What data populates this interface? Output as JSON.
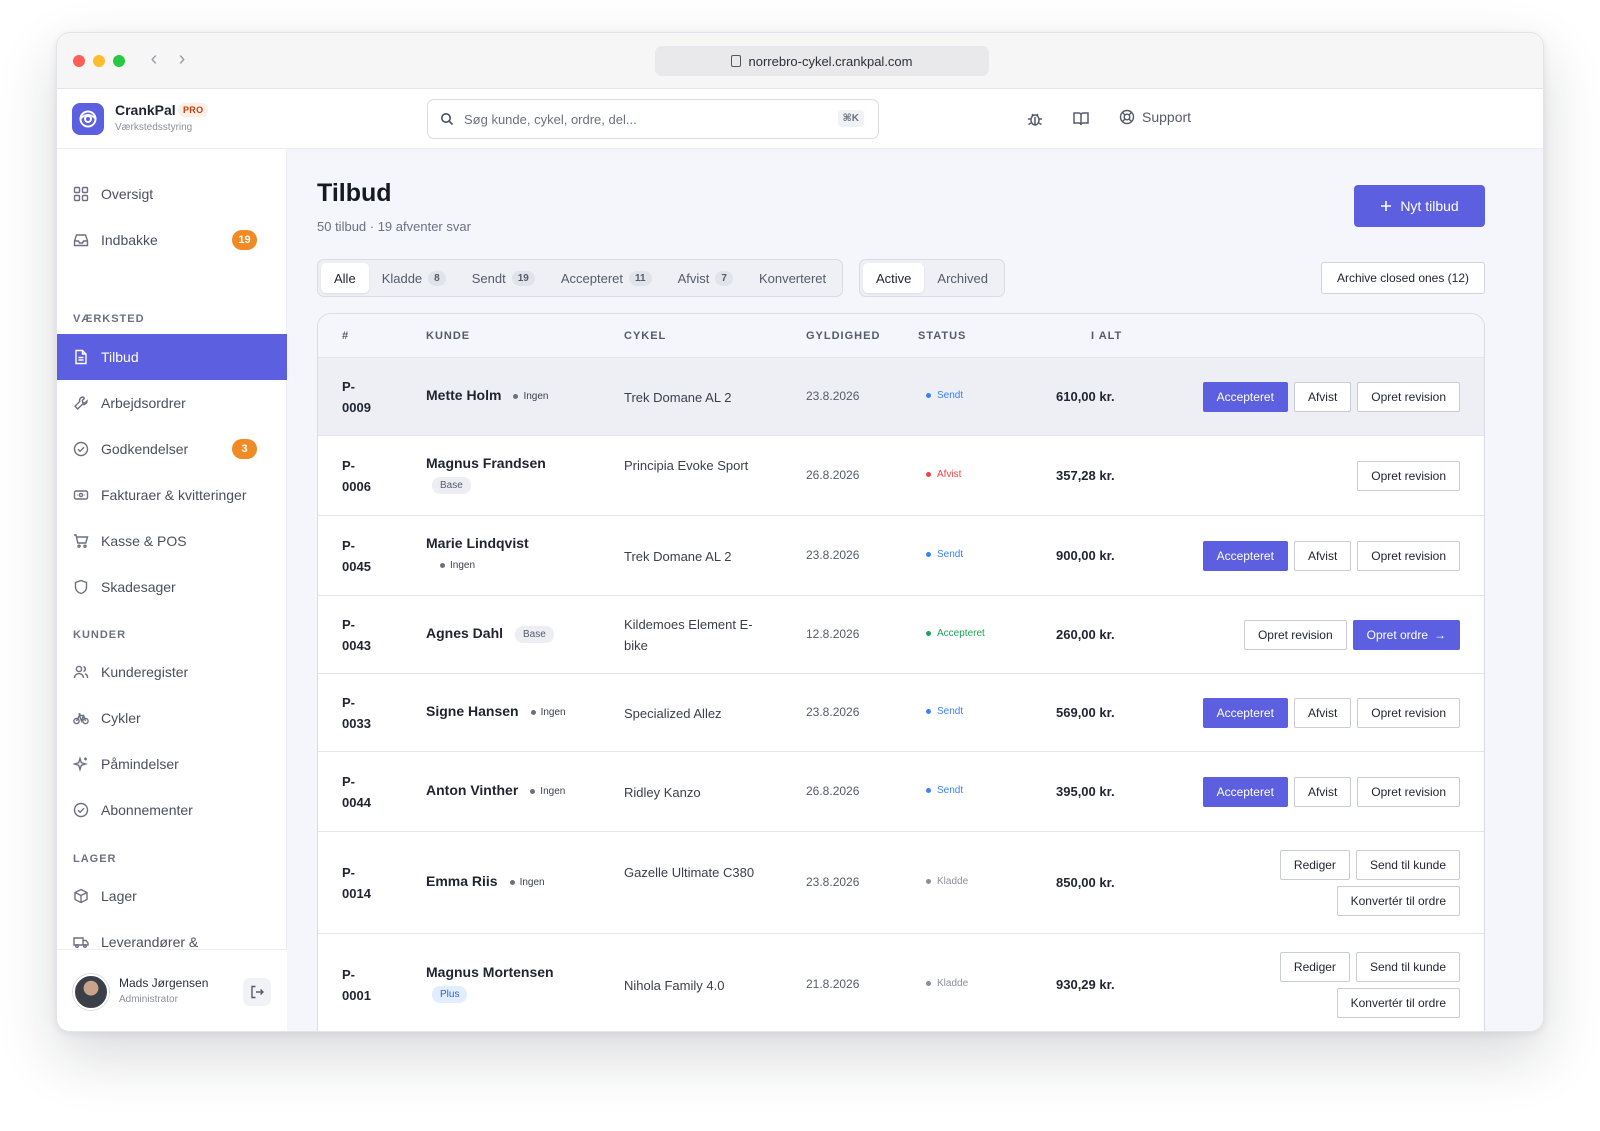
{
  "browser": {
    "url": "norrebro-cykel.crankpal.com"
  },
  "brand": {
    "name": "CrankPal",
    "badge": "PRO",
    "subtitle": "Værkstedsstyring"
  },
  "search": {
    "placeholder": "Søg kunde, cykel, ordre, del...",
    "shortcut": "⌘K"
  },
  "topbar": {
    "support_label": "Support"
  },
  "sidebar": {
    "items_top": [
      {
        "label": "Oversigt",
        "icon": "grid-icon"
      },
      {
        "label": "Indbakke",
        "icon": "inbox-icon",
        "badge": "19"
      }
    ],
    "sections": [
      {
        "label": "VÆRKSTED",
        "items": [
          {
            "label": "Tilbud",
            "icon": "document-icon",
            "active": true
          },
          {
            "label": "Arbejdsordrer",
            "icon": "wrench-icon"
          },
          {
            "label": "Godkendelser",
            "icon": "check-circle-icon",
            "badge": "3"
          },
          {
            "label": "Fakturaer & kvitteringer",
            "icon": "receipt-icon"
          },
          {
            "label": "Kasse & POS",
            "icon": "cart-icon"
          },
          {
            "label": "Skadesager",
            "icon": "shield-icon"
          }
        ]
      },
      {
        "label": "KUNDER",
        "items": [
          {
            "label": "Kunderegister",
            "icon": "users-icon"
          },
          {
            "label": "Cykler",
            "icon": "bike-icon"
          },
          {
            "label": "Påmindelser",
            "icon": "sparkle-icon"
          },
          {
            "label": "Abonnementer",
            "icon": "check-circle-icon"
          }
        ]
      },
      {
        "label": "LAGER",
        "items": [
          {
            "label": "Lager",
            "icon": "box-icon"
          },
          {
            "label": "Leverandører &",
            "icon": "truck-icon"
          }
        ]
      }
    ],
    "user": {
      "name": "Mads Jørgensen",
      "role": "Administrator"
    }
  },
  "page": {
    "title": "Tilbud",
    "subtitle": "50 tilbud · 19 afventer svar",
    "new_button": "Nyt tilbud",
    "archive_button": "Archive closed ones (12)",
    "filter_tabs": [
      {
        "label": "Alle",
        "active": true
      },
      {
        "label": "Kladde",
        "count": "8"
      },
      {
        "label": "Sendt",
        "count": "19"
      },
      {
        "label": "Accepteret",
        "count": "11"
      },
      {
        "label": "Afvist",
        "count": "7"
      },
      {
        "label": "Konverteret"
      }
    ],
    "scope_tabs": [
      {
        "label": "Active",
        "active": true
      },
      {
        "label": "Archived"
      }
    ]
  },
  "table": {
    "headers": {
      "id": "#",
      "customer": "KUNDE",
      "bike": "CYKEL",
      "validity": "GYLDIGHED",
      "status": "STATUS",
      "total": "I ALT"
    },
    "status_colors": {
      "Sendt": "#3b82f6",
      "Afvist": "#ef4444",
      "Accepteret": "#22a35a",
      "Kladde": "#8a8f9c"
    },
    "rows": [
      {
        "id_prefix": "P-",
        "id_num": "0009",
        "customer": "Mette Holm",
        "plan": "Ingen",
        "bike": "Trek Domane AL 2",
        "validity": "23.8.2026",
        "status": "Sendt",
        "total": "610,00 kr.",
        "actions": [
          [
            "Accepteret",
            "Afvist",
            "Opret revision"
          ]
        ]
      },
      {
        "id_prefix": "P-",
        "id_num": "0006",
        "customer": "Magnus Frandsen",
        "plan": "Base",
        "bike": "Principia Evoke Sport",
        "validity": "26.8.2026",
        "status": "Afvist",
        "total": "357,28 kr.",
        "actions": [
          [
            "Opret revision"
          ]
        ]
      },
      {
        "id_prefix": "P-",
        "id_num": "0045",
        "customer": "Marie Lindqvist",
        "plan": "Ingen",
        "bike": "Trek Domane AL 2",
        "validity": "23.8.2026",
        "status": "Sendt",
        "total": "900,00 kr.",
        "actions": [
          [
            "Accepteret",
            "Afvist",
            "Opret revision"
          ]
        ]
      },
      {
        "id_prefix": "P-",
        "id_num": "0043",
        "customer": "Agnes Dahl",
        "plan": "Base",
        "bike": "Kildemoes Element E-bike",
        "validity": "12.8.2026",
        "status": "Accepteret",
        "total": "260,00 kr.",
        "actions": [
          [
            "Opret revision",
            "Opret ordre"
          ]
        ]
      },
      {
        "id_prefix": "P-",
        "id_num": "0033",
        "customer": "Signe Hansen",
        "plan": "Ingen",
        "bike": "Specialized Allez",
        "validity": "23.8.2026",
        "status": "Sendt",
        "total": "569,00 kr.",
        "actions": [
          [
            "Accepteret",
            "Afvist",
            "Opret revision"
          ]
        ]
      },
      {
        "id_prefix": "P-",
        "id_num": "0044",
        "customer": "Anton Vinther",
        "plan": "Ingen",
        "bike": "Ridley Kanzo",
        "validity": "26.8.2026",
        "status": "Sendt",
        "total": "395,00 kr.",
        "actions": [
          [
            "Accepteret",
            "Afvist",
            "Opret revision"
          ]
        ]
      },
      {
        "id_prefix": "P-",
        "id_num": "0014",
        "customer": "Emma Riis",
        "plan": "Ingen",
        "bike": "Gazelle Ultimate C380",
        "validity": "23.8.2026",
        "status": "Kladde",
        "total": "850,00 kr.",
        "actions": [
          [
            "Rediger",
            "Send til kunde"
          ],
          [
            "Konvertér til ordre"
          ]
        ]
      },
      {
        "id_prefix": "P-",
        "id_num": "0001",
        "customer": "Magnus Mortensen",
        "plan": "Plus",
        "bike": "Nihola Family 4.0",
        "validity": "21.8.2026",
        "status": "Kladde",
        "total": "930,29 kr.",
        "actions": [
          [
            "Rediger",
            "Send til kunde"
          ],
          [
            "Konvertér til ordre"
          ]
        ]
      }
    ]
  }
}
